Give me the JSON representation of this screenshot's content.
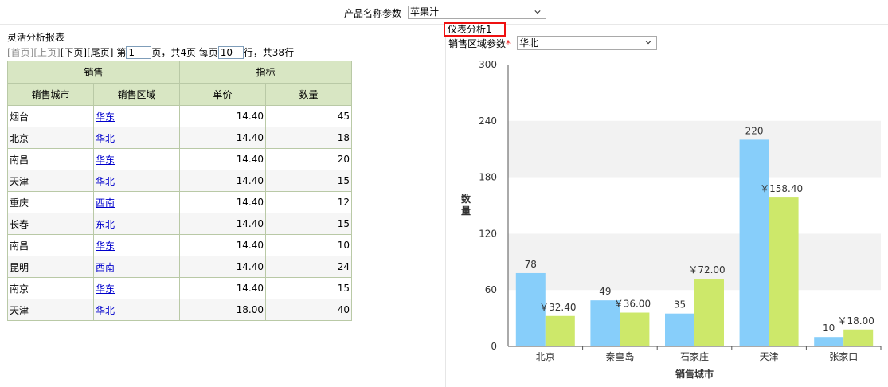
{
  "top_param": {
    "label": "产品名称参数",
    "value": "苹果汁"
  },
  "report": {
    "title": "灵活分析报表",
    "pager": {
      "first": "[首页]",
      "prev": "[上页]",
      "next": "[下页]",
      "last": "[尾页]",
      "page_prefix": "第",
      "page_value": "1",
      "page_suffix": "页，共4页 每页",
      "size_value": "10",
      "size_suffix": "行，共38行"
    },
    "header_groups": [
      "销售",
      "指标"
    ],
    "columns": [
      "销售城市",
      "销售区域",
      "单价",
      "数量"
    ],
    "rows": [
      {
        "city": "烟台",
        "region": "华东",
        "price": "14.40",
        "qty": "45"
      },
      {
        "city": "北京",
        "region": "华北",
        "price": "14.40",
        "qty": "18"
      },
      {
        "city": "南昌",
        "region": "华东",
        "price": "14.40",
        "qty": "20"
      },
      {
        "city": "天津",
        "region": "华北",
        "price": "14.40",
        "qty": "15"
      },
      {
        "city": "重庆",
        "region": "西南",
        "price": "14.40",
        "qty": "12"
      },
      {
        "city": "长春",
        "region": "东北",
        "price": "14.40",
        "qty": "15"
      },
      {
        "city": "南昌",
        "region": "华东",
        "price": "14.40",
        "qty": "10"
      },
      {
        "city": "昆明",
        "region": "西南",
        "price": "14.40",
        "qty": "24"
      },
      {
        "city": "南京",
        "region": "华东",
        "price": "14.40",
        "qty": "15"
      },
      {
        "city": "天津",
        "region": "华北",
        "price": "18.00",
        "qty": "40"
      }
    ]
  },
  "chart_panel": {
    "title": "仪表分析1",
    "region_label": "销售区域参数",
    "region_required_mark": "*",
    "region_value": "华北"
  },
  "colors": {
    "series_qty": "#87cefa",
    "series_amount": "#cde86a",
    "header_bg": "#d8e6c3",
    "highlight_border": "#ee1111"
  },
  "chart_data": {
    "type": "bar",
    "categories": [
      "北京",
      "秦皇岛",
      "石家庄",
      "天津",
      "张家口"
    ],
    "series": [
      {
        "values": [
          78,
          49,
          35,
          220,
          10
        ],
        "labels": [
          "78",
          "49",
          "35",
          "220",
          "10"
        ]
      },
      {
        "values": [
          32.4,
          36,
          72,
          158.4,
          18
        ],
        "labels": [
          "￥32.40",
          "￥36.00",
          "￥72.00",
          "￥158.40",
          "￥18.00"
        ]
      }
    ],
    "xlabel": "销售城市",
    "ylabel": "数量",
    "ylim": [
      0,
      300
    ],
    "yticks": [
      "0",
      "60",
      "120",
      "180",
      "240",
      "300"
    ],
    "grid": "alternating-bands",
    "legend": "none"
  }
}
